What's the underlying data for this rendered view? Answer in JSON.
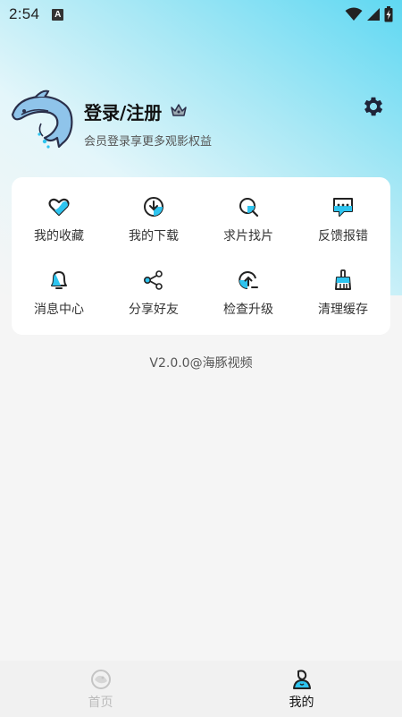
{
  "status_bar": {
    "time": "2:54",
    "notification_badge": "A"
  },
  "profile": {
    "title": "登录/注册",
    "subtitle": "会员登录享更多观影权益"
  },
  "menu": [
    {
      "label": "我的收藏",
      "icon": "heart-icon"
    },
    {
      "label": "我的下载",
      "icon": "download-icon"
    },
    {
      "label": "求片找片",
      "icon": "search-icon"
    },
    {
      "label": "反馈报错",
      "icon": "feedback-icon"
    },
    {
      "label": "消息中心",
      "icon": "bell-icon"
    },
    {
      "label": "分享好友",
      "icon": "share-icon"
    },
    {
      "label": "检查升级",
      "icon": "upgrade-icon"
    },
    {
      "label": "清理缓存",
      "icon": "broom-icon"
    }
  ],
  "version": "V2.0.0@海豚视频",
  "bottom_nav": {
    "home": "首页",
    "mine": "我的"
  },
  "colors": {
    "accent": "#2ec4ef",
    "gradient_top": "#5fd8f2",
    "background": "#f5f5f5"
  }
}
